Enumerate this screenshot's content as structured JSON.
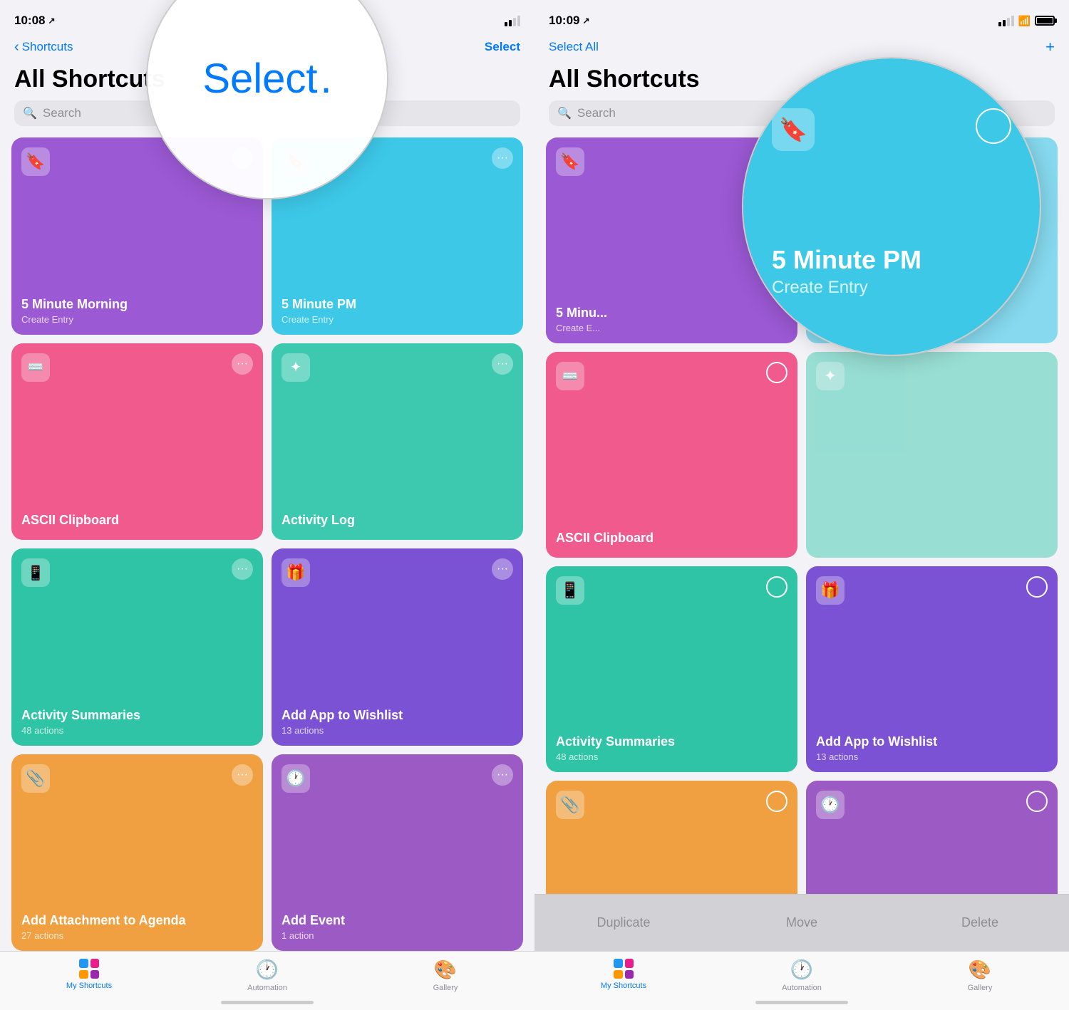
{
  "left": {
    "status": {
      "time": "10:08",
      "location": "↗"
    },
    "nav": {
      "back_label": "Shortcuts",
      "select_label": "Select"
    },
    "page_title": "All Shortcuts",
    "search_placeholder": "Search",
    "cards": [
      {
        "id": "five-morning",
        "name": "5 Minute Morning",
        "sub": "Create Entry",
        "color": "#9b59d4",
        "icon": "🔖",
        "col": 0
      },
      {
        "id": "five-pm",
        "name": "5 Minute PM",
        "sub": "Create Entry",
        "color": "#3dc8e8",
        "icon": "🔖",
        "col": 1
      },
      {
        "id": "ascii",
        "name": "ASCII Clipboard",
        "sub": "",
        "color": "#f05a8c",
        "icon": "⌨",
        "col": 0
      },
      {
        "id": "actlog",
        "name": "Activity Log",
        "sub": "",
        "color": "#3dc9b0",
        "icon": "✦",
        "col": 1
      },
      {
        "id": "actsummaries",
        "name": "Activity Summaries",
        "sub": "48 actions",
        "color": "#2ec4a5",
        "icon": "📱",
        "col": 0
      },
      {
        "id": "addappwishlist",
        "name": "Add App to Wishlist",
        "sub": "13 actions",
        "color": "#7b52d3",
        "icon": "🎁",
        "col": 1
      },
      {
        "id": "addattachment",
        "name": "Add Attachment to Agenda",
        "sub": "27 actions",
        "color": "#f0a040",
        "icon": "📎",
        "col": 0
      },
      {
        "id": "addevent",
        "name": "Add Event",
        "sub": "1 action",
        "color": "#9c5bc4",
        "icon": "🕐",
        "col": 1
      }
    ],
    "tabs": [
      {
        "id": "my-shortcuts",
        "label": "My Shortcuts",
        "active": true
      },
      {
        "id": "automation",
        "label": "Automation",
        "active": false
      },
      {
        "id": "gallery",
        "label": "Gallery",
        "active": false
      }
    ],
    "circle_select": "Select"
  },
  "right": {
    "status": {
      "time": "10:09",
      "location": "↗"
    },
    "nav": {
      "select_all_label": "Select All",
      "plus_label": "+"
    },
    "page_title": "All Shortcuts",
    "search_placeholder": "Search",
    "circle_card": {
      "name": "5 Minute PM",
      "sub": "Create Entry",
      "icon": "🔖"
    },
    "action_sheet": {
      "duplicate": "Duplicate",
      "move": "Move",
      "delete": "Delete"
    },
    "tabs": [
      {
        "id": "my-shortcuts",
        "label": "My Shortcuts",
        "active": true
      },
      {
        "id": "automation",
        "label": "Automation",
        "active": false
      },
      {
        "id": "gallery",
        "label": "Gallery",
        "active": false
      }
    ]
  }
}
